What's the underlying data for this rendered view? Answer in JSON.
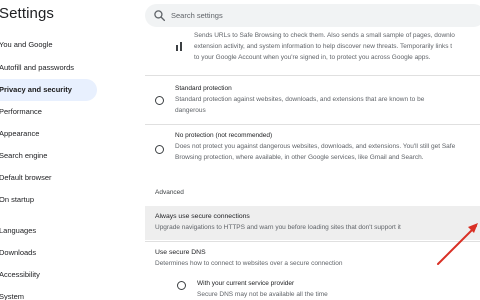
{
  "app_title": "Settings",
  "search": {
    "placeholder": "Search settings"
  },
  "sidebar": {
    "items": [
      {
        "label": "You and Google"
      },
      {
        "label": "Autofill and passwords"
      },
      {
        "label": "Privacy and security",
        "active": true
      },
      {
        "label": "Performance"
      },
      {
        "label": "Appearance"
      },
      {
        "label": "Search engine"
      },
      {
        "label": "Default browser"
      },
      {
        "label": "On startup"
      },
      {
        "label": "Languages"
      },
      {
        "label": "Downloads"
      },
      {
        "label": "Accessibility"
      },
      {
        "label": "System"
      }
    ]
  },
  "enhanced_desc": {
    "line1": "Sends URLs to Safe Browsing to check them. Also sends a small sample of pages, downlo",
    "line2": "extension activity, and system information to help discover new threats. Temporarily links t",
    "line3": "to your Google Account when you're signed in, to protect you across Google apps."
  },
  "standard": {
    "title": "Standard protection",
    "desc1": "Standard protection against websites, downloads, and extensions that are known to be",
    "desc2": "dangerous"
  },
  "no_protection": {
    "title": "No protection (not recommended)",
    "desc1": "Does not protect you against dangerous websites, downloads, and extensions. You'll still get Safe",
    "desc2": "Browsing protection, where available, in other Google services, like Gmail and Search."
  },
  "advanced": {
    "label": "Advanced"
  },
  "secure_connections": {
    "title": "Always use secure connections",
    "desc": "Upgrade navigations to HTTPS and warn you before loading sites that don't support it"
  },
  "secure_dns": {
    "title": "Use secure DNS",
    "desc": "Determines how to connect to websites over a secure connection"
  },
  "current_provider": {
    "title": "With your current service provider",
    "desc": "Secure DNS may not be available all the time"
  },
  "colors": {
    "accent": "#1a73e8",
    "active_nav_bg": "#e8f0fe",
    "arrow": "#d93025"
  }
}
